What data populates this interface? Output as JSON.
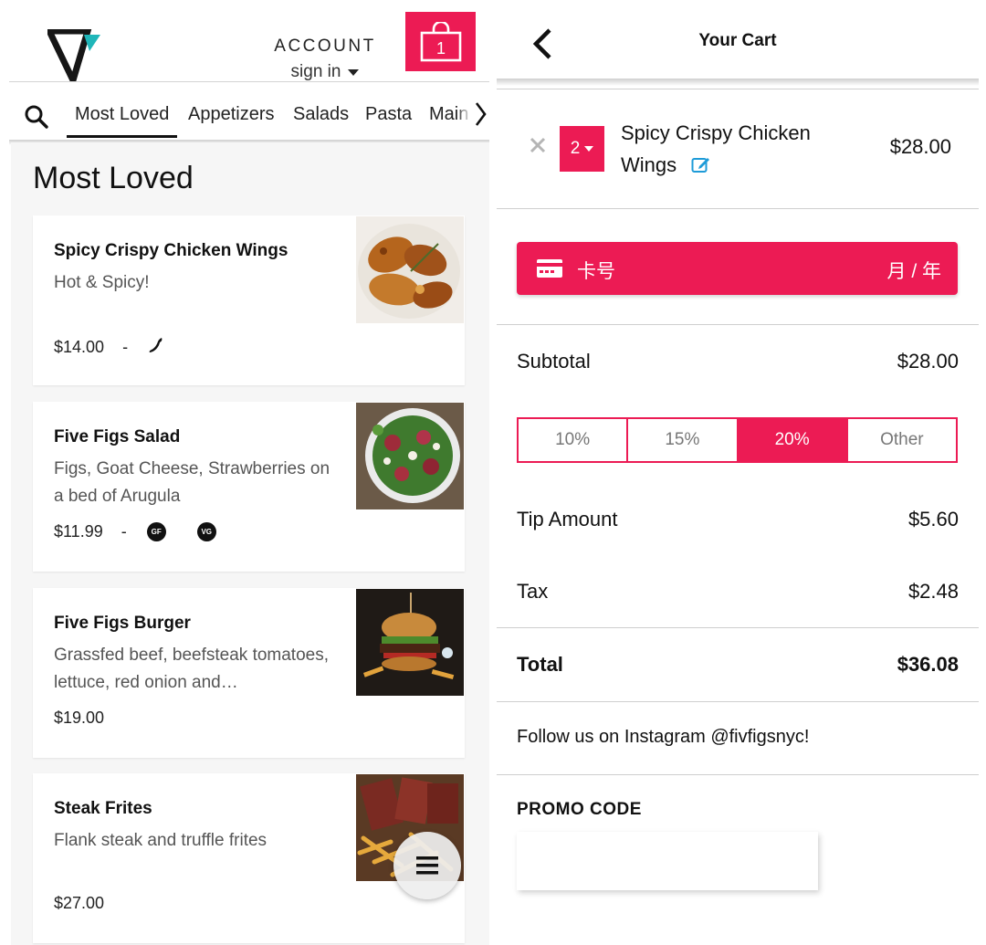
{
  "header": {
    "account_label": "ACCOUNT",
    "signin_label": "sign in",
    "cart_count": "1",
    "brand_color": "#ec1b54"
  },
  "nav": {
    "tabs": [
      {
        "label": "Most Loved",
        "active": true
      },
      {
        "label": "Appetizers"
      },
      {
        "label": "Salads"
      },
      {
        "label": "Pasta"
      },
      {
        "label": "Main"
      }
    ]
  },
  "menu": {
    "section_title": "Most Loved",
    "items": [
      {
        "name": "Spicy Crispy Chicken Wings",
        "desc": "Hot & Spicy!",
        "price": "$14.00",
        "dash": "-",
        "tags": [
          "chili-pepper-icon"
        ]
      },
      {
        "name": "Five Figs Salad",
        "desc": "Figs, Goat Cheese, Strawberries on a bed of Arugula",
        "price": "$11.99",
        "dash": "-",
        "tags": [
          "GF",
          "VG"
        ]
      },
      {
        "name": "Five Figs Burger",
        "desc": "Grassfed beef, beefsteak tomatoes, lettuce, red onion and…",
        "price": "$19.00"
      },
      {
        "name": "Steak Frites",
        "desc": "Flank steak and truffle frites",
        "price": "$27.00"
      }
    ]
  },
  "cart": {
    "title": "Your Cart",
    "item": {
      "quantity": "2",
      "name": "Spicy Crispy Chicken Wings",
      "price": "$28.00"
    },
    "payment": {
      "card_placeholder": "卡号",
      "expiry_placeholder": "月 / 年"
    },
    "subtotal_label": "Subtotal",
    "subtotal_value": "$28.00",
    "tip_options": [
      "10%",
      "15%",
      "20%",
      "Other"
    ],
    "tip_selected": "20%",
    "tip_label": "Tip Amount",
    "tip_value": "$5.60",
    "tax_label": "Tax",
    "tax_value": "$2.48",
    "total_label": "Total",
    "total_value": "$36.08",
    "follow_text": "Follow us on Instagram @fivfigsnyc!",
    "promo_label": "PROMO CODE",
    "promo_value": ""
  }
}
